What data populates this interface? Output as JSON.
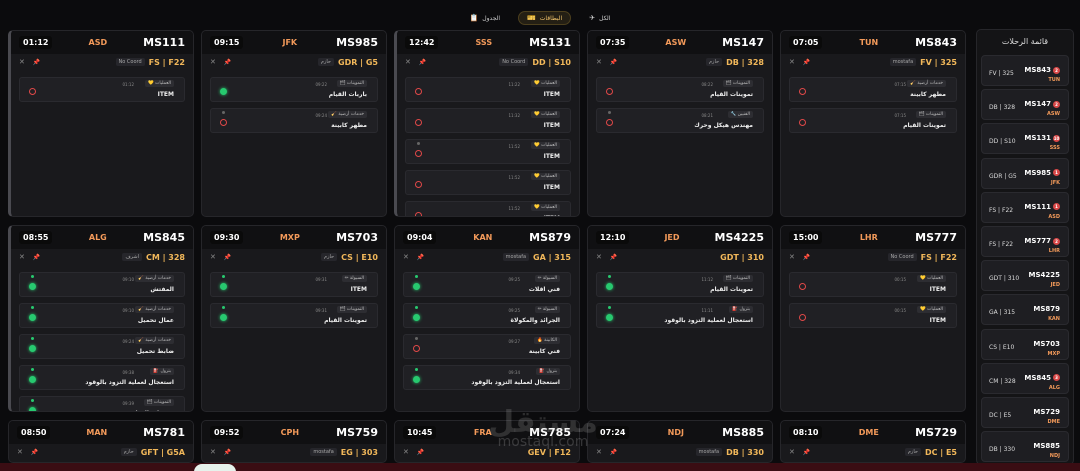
{
  "nav": [
    {
      "label": "الجدول",
      "icon": "📋",
      "active": false
    },
    {
      "label": "البطاقات",
      "icon": "🎫",
      "active": true
    },
    {
      "label": "الكل",
      "icon": "✈",
      "active": false
    }
  ],
  "cards": [
    {
      "flight": "MS111",
      "dest": "ASD",
      "time": "01:12",
      "gate": "FS | F22",
      "coord": "No Coord",
      "scroll": true,
      "tasks": [
        {
          "tag": "💛 العمليات",
          "time": "01:12",
          "name": "ITEM",
          "status": "red",
          "mini": false
        }
      ]
    },
    {
      "flight": "MS985",
      "dest": "JFK",
      "time": "09:15",
      "gate": "GDR | G5",
      "coord": "حازم",
      "scroll": false,
      "tasks": [
        {
          "tag": "🗂 التموينات",
          "time": "09:22",
          "name": "باربات القيام",
          "status": "green",
          "mini": false
        },
        {
          "tag": "🧹 خدمات أرضية",
          "time": "09:24",
          "name": "مطهر كابينة",
          "status": "red",
          "mini": true
        }
      ]
    },
    {
      "flight": "MS131",
      "dest": "SSS",
      "time": "12:42",
      "gate": "DD | S10",
      "coord": "No Coord",
      "scroll": true,
      "tasks": [
        {
          "tag": "💛 العمليات",
          "time": "11:22",
          "name": "ITEM",
          "status": "red",
          "mini": false
        },
        {
          "tag": "💛 العمليات",
          "time": "11:32",
          "name": "ITEM",
          "status": "red",
          "mini": false
        },
        {
          "tag": "💛 العمليات",
          "time": "11:52",
          "name": "ITEM",
          "status": "red",
          "mini": true
        },
        {
          "tag": "💛 العمليات",
          "time": "11:52",
          "name": "ITEM",
          "status": "red",
          "mini": false
        },
        {
          "tag": "💛 العمليات",
          "time": "11:52",
          "name": "ITEM",
          "status": "red",
          "mini": false
        }
      ]
    },
    {
      "flight": "MS147",
      "dest": "ASW",
      "time": "07:35",
      "gate": "DB | 328",
      "coord": "حازم",
      "scroll": false,
      "tasks": [
        {
          "tag": "🗂 التموينات",
          "time": "08:22",
          "name": "تموينات القيام",
          "status": "red",
          "mini": false
        },
        {
          "tag": "🔧 الفنيين",
          "time": "08:21",
          "name": "مهندس هيكل وحرك",
          "status": "red",
          "mini": true
        }
      ]
    },
    {
      "flight": "MS843",
      "dest": "TUN",
      "time": "07:05",
      "gate": "FV | 325",
      "coord": "mostafa",
      "scroll": false,
      "tasks": [
        {
          "tag": "🧹 خدمات أرضية",
          "time": "07:15",
          "name": "مطهر كابينة",
          "status": "red",
          "mini": false
        },
        {
          "tag": "🗂 التموينات",
          "time": "07:15",
          "name": "تموينات القيام",
          "status": "red",
          "mini": false
        }
      ]
    },
    {
      "flight": "MS845",
      "dest": "ALG",
      "time": "08:55",
      "gate": "CM | 328",
      "coord": "اشرف",
      "scroll": true,
      "tasks": [
        {
          "tag": "🧹 خدمات أرضية",
          "time": "09:10",
          "name": "المفتش",
          "status": "green",
          "mini": true
        },
        {
          "tag": "🧹 خدمات أرضية",
          "time": "09:10",
          "name": "عمال تحميل",
          "status": "green",
          "mini": true
        },
        {
          "tag": "🧹 خدمات أرضية",
          "time": "09:24",
          "name": "ضابط تحميل",
          "status": "green",
          "mini": true
        },
        {
          "tag": "⛽ بترول",
          "time": "09:38",
          "name": "استعجال لعملية التزود بالوقود",
          "status": "green",
          "mini": true
        },
        {
          "tag": "🗂 التموينات",
          "time": "09:39",
          "name": "تموينات القيام",
          "status": "green",
          "mini": true
        }
      ]
    },
    {
      "flight": "MS703",
      "dest": "MXP",
      "time": "09:30",
      "gate": "CS | E10",
      "coord": "حازم",
      "scroll": false,
      "tasks": [
        {
          "tag": "✏ السيولة",
          "time": "09:31",
          "name": "ITEM",
          "status": "green",
          "mini": true
        },
        {
          "tag": "🗂 التموينات",
          "time": "09:31",
          "name": "تموينات القيام",
          "status": "green",
          "mini": true
        }
      ]
    },
    {
      "flight": "MS879",
      "dest": "KAN",
      "time": "09:04",
      "gate": "GA | 315",
      "coord": "mostafa",
      "scroll": false,
      "tasks": [
        {
          "tag": "✏ السيولة",
          "time": "09:25",
          "name": "فني اقلات",
          "status": "green",
          "mini": true
        },
        {
          "tag": "✏ السيولة",
          "time": "09:25",
          "name": "الجرائد والمكولاة",
          "status": "green",
          "mini": true
        },
        {
          "tag": "🔥 الكابينة",
          "time": "09:27",
          "name": "فني كابينة",
          "status": "red",
          "mini": true
        },
        {
          "tag": "⛽ بترول",
          "time": "09:34",
          "name": "استعجال لعملية التزود بالوقود",
          "status": "green",
          "mini": true
        }
      ]
    },
    {
      "flight": "MS4225",
      "dest": "JED",
      "time": "12:10",
      "gate": "GDT | 310",
      "coord": "",
      "scroll": false,
      "tasks": [
        {
          "tag": "🗂 التموينات",
          "time": "11:12",
          "name": "تموينات القيام",
          "status": "green",
          "mini": true
        },
        {
          "tag": "⛽ بترول",
          "time": "11:11",
          "name": "استعجال لعملية التزود بالوقود",
          "status": "green",
          "mini": true
        }
      ]
    },
    {
      "flight": "MS777",
      "dest": "LHR",
      "time": "15:00",
      "gate": "FS | F22",
      "coord": "No Coord",
      "scroll": false,
      "tasks": [
        {
          "tag": "💛 العمليات",
          "time": "00:15",
          "name": "ITEM",
          "status": "red",
          "mini": false
        },
        {
          "tag": "💛 العمليات",
          "time": "00:15",
          "name": "ITEM",
          "status": "red",
          "mini": false
        }
      ]
    },
    {
      "flight": "MS781",
      "dest": "MAN",
      "time": "08:50",
      "gate": "GFT | G5A",
      "coord": "حازم",
      "scroll": false,
      "tasks": []
    },
    {
      "flight": "MS759",
      "dest": "CPH",
      "time": "09:52",
      "gate": "EG | 303",
      "coord": "mostafa",
      "scroll": false,
      "tasks": []
    },
    {
      "flight": "MS785",
      "dest": "FRA",
      "time": "10:45",
      "gate": "GEV | F12",
      "coord": "",
      "scroll": false,
      "tasks": []
    },
    {
      "flight": "MS885",
      "dest": "NDJ",
      "time": "07:24",
      "gate": "DB | 330",
      "coord": "mostafa",
      "scroll": false,
      "tasks": []
    },
    {
      "flight": "MS729",
      "dest": "DME",
      "time": "08:10",
      "gate": "DC | E5",
      "coord": "حازم",
      "scroll": false,
      "tasks": []
    }
  ],
  "sidebar": {
    "title": "قائمة الرحلات",
    "items": [
      {
        "flight": "MS843",
        "badge": "2",
        "dest": "TUN",
        "gate": "FV | 325"
      },
      {
        "flight": "MS147",
        "badge": "2",
        "dest": "ASW",
        "gate": "DB | 328"
      },
      {
        "flight": "MS131",
        "badge": "10",
        "dest": "SSS",
        "gate": "DD | S10"
      },
      {
        "flight": "MS985",
        "badge": "1",
        "dest": "JFK",
        "gate": "GDR | G5"
      },
      {
        "flight": "MS111",
        "badge": "1",
        "dest": "ASD",
        "gate": "FS | F22"
      },
      {
        "flight": "MS777",
        "badge": "2",
        "dest": "LHR",
        "gate": "FS | F22"
      },
      {
        "flight": "MS4225",
        "badge": "",
        "dest": "JED",
        "gate": "GDT | 310"
      },
      {
        "flight": "MS879",
        "badge": "",
        "dest": "KAN",
        "gate": "GA | 315"
      },
      {
        "flight": "MS703",
        "badge": "",
        "dest": "MXP",
        "gate": "CS | E10"
      },
      {
        "flight": "MS845",
        "badge": "3",
        "dest": "ALG",
        "gate": "CM | 328"
      },
      {
        "flight": "MS729",
        "badge": "",
        "dest": "DME",
        "gate": "DC | E5"
      },
      {
        "flight": "MS885",
        "badge": "",
        "dest": "NDJ",
        "gate": "DB | 330"
      }
    ]
  },
  "watermark": {
    "arabic": "مستقل",
    "latin": "mostaql.com"
  }
}
